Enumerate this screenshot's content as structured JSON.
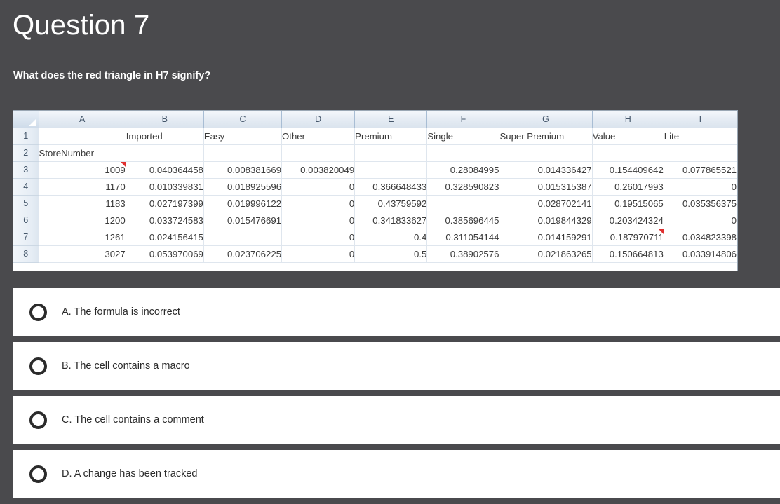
{
  "question": {
    "title": "Question 7",
    "prompt": "What does the red triangle in H7 signify?"
  },
  "spreadsheet": {
    "column_headers": [
      "A",
      "B",
      "C",
      "D",
      "E",
      "F",
      "G",
      "H",
      "I"
    ],
    "row_numbers": [
      "1",
      "2",
      "3",
      "4",
      "5",
      "6",
      "7",
      "8"
    ],
    "comment_cells": [
      "A3",
      "H7"
    ],
    "rows": [
      {
        "number": "1",
        "cells": [
          "",
          "Imported",
          "Easy",
          "Other",
          "Premium",
          "Single",
          "Super Premium",
          "Value",
          "Lite"
        ],
        "align": [
          "txt",
          "txt",
          "txt",
          "txt",
          "txt",
          "txt",
          "txt",
          "txt",
          "txt"
        ]
      },
      {
        "number": "2",
        "cells": [
          "StoreNumber",
          "",
          "",
          "",
          "",
          "",
          "",
          "",
          ""
        ],
        "align": [
          "txt",
          "txt",
          "txt",
          "txt",
          "txt",
          "txt",
          "txt",
          "txt",
          "txt"
        ]
      },
      {
        "number": "3",
        "cells": [
          "1009",
          "0.040364458",
          "0.008381669",
          "0.003820049",
          "",
          "0.28084995",
          "0.014336427",
          "0.154409642",
          "0.077865521"
        ],
        "align": [
          "num",
          "num",
          "num",
          "num",
          "num",
          "num",
          "num",
          "num",
          "num"
        ]
      },
      {
        "number": "4",
        "cells": [
          "1170",
          "0.010339831",
          "0.018925596",
          "0",
          "0.366648433",
          "0.328590823",
          "0.015315387",
          "0.26017993",
          "0"
        ],
        "align": [
          "num",
          "num",
          "num",
          "num",
          "num",
          "num",
          "num",
          "num",
          "num"
        ]
      },
      {
        "number": "5",
        "cells": [
          "1183",
          "0.027197399",
          "0.019996122",
          "0",
          "0.43759592",
          "",
          "0.028702141",
          "0.19515065",
          "0.035356375"
        ],
        "align": [
          "num",
          "num",
          "num",
          "num",
          "num",
          "num",
          "num",
          "num",
          "num"
        ]
      },
      {
        "number": "6",
        "cells": [
          "1200",
          "0.033724583",
          "0.015476691",
          "0",
          "0.341833627",
          "0.385696445",
          "0.019844329",
          "0.203424324",
          "0"
        ],
        "align": [
          "num",
          "num",
          "num",
          "num",
          "num",
          "num",
          "num",
          "num",
          "num"
        ]
      },
      {
        "number": "7",
        "cells": [
          "1261",
          "0.024156415",
          "",
          "0",
          "0.4",
          "0.311054144",
          "0.014159291",
          "0.187970711",
          "0.034823398"
        ],
        "align": [
          "num",
          "num",
          "num",
          "num",
          "num",
          "num",
          "num",
          "num",
          "num"
        ]
      },
      {
        "number": "8",
        "cells": [
          "3027",
          "0.053970069",
          "0.023706225",
          "0",
          "0.5",
          "0.38902576",
          "0.021863265",
          "0.150664813",
          "0.033914806"
        ],
        "align": [
          "num",
          "num",
          "num",
          "num",
          "num",
          "num",
          "num",
          "num",
          "num"
        ]
      }
    ]
  },
  "answers": {
    "options": [
      {
        "label": "A. The formula is incorrect"
      },
      {
        "label": "B. The cell contains a macro"
      },
      {
        "label": "C. The cell contains a comment"
      },
      {
        "label": "D. A change has been tracked"
      }
    ]
  },
  "colors": {
    "background": "#4a4a4d",
    "panel": "#ffffff",
    "comment_marker": "#e03030",
    "text_light": "#ffffff",
    "text_dark": "#2b2b2b"
  }
}
